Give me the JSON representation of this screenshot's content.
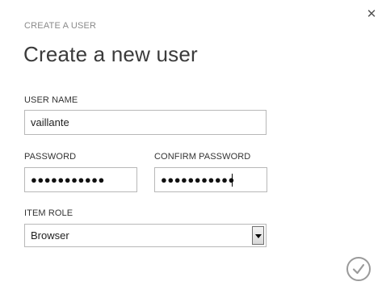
{
  "dialog": {
    "subtitle": "CREATE A USER",
    "title": "Create a new user",
    "close_glyph": "✕"
  },
  "form": {
    "username": {
      "label": "USER NAME",
      "value": "vaillante"
    },
    "password": {
      "label": "PASSWORD",
      "masked_value": "●●●●●●●●●●●"
    },
    "confirm_password": {
      "label": "CONFIRM PASSWORD",
      "masked_value": "●●●●●●●●●●●"
    },
    "item_role": {
      "label": "ITEM ROLE",
      "selected": "Browser"
    }
  },
  "icons": {
    "close": "close-icon",
    "confirm": "checkmark-icon",
    "dropdown": "chevron-down-icon"
  }
}
